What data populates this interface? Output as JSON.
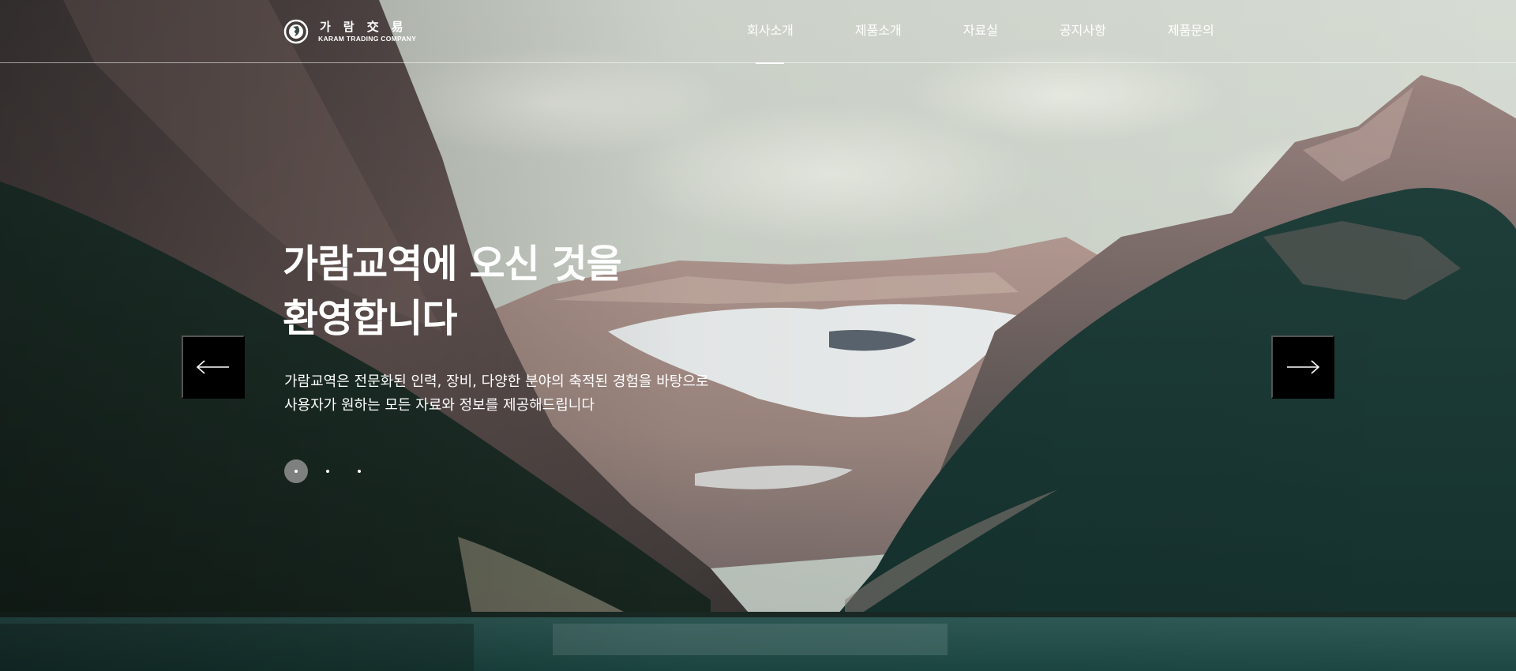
{
  "brand": {
    "name_ko": "가람交易",
    "name_en": "KARAM TRADING COMPANY",
    "logo_icon": "karam-emblem-icon"
  },
  "nav": {
    "items": [
      {
        "label": "회사소개",
        "active": true
      },
      {
        "label": "제품소개",
        "active": false
      },
      {
        "label": "자료실",
        "active": false
      },
      {
        "label": "공지사항",
        "active": false
      },
      {
        "label": "제품문의",
        "active": false
      }
    ]
  },
  "hero": {
    "title_line1": "가람교역에 오신 것을",
    "title_line2": "환영합니다",
    "desc_line1": "가람교역은 전문화된 인력, 장비, 다양한 분야의 축적된 경험을 바탕으로",
    "desc_line2": "사용자가 원하는 모든 자료와 정보를 제공해드립니다",
    "background": "mountain-lake-landscape"
  },
  "slider": {
    "prev_icon": "arrow-left-icon",
    "next_icon": "arrow-right-icon",
    "slide_count": 3,
    "active_slide": 1
  },
  "colors": {
    "arrow_bg": "#000000",
    "text": "#ffffff",
    "active_dot": "#a0a0a0"
  }
}
